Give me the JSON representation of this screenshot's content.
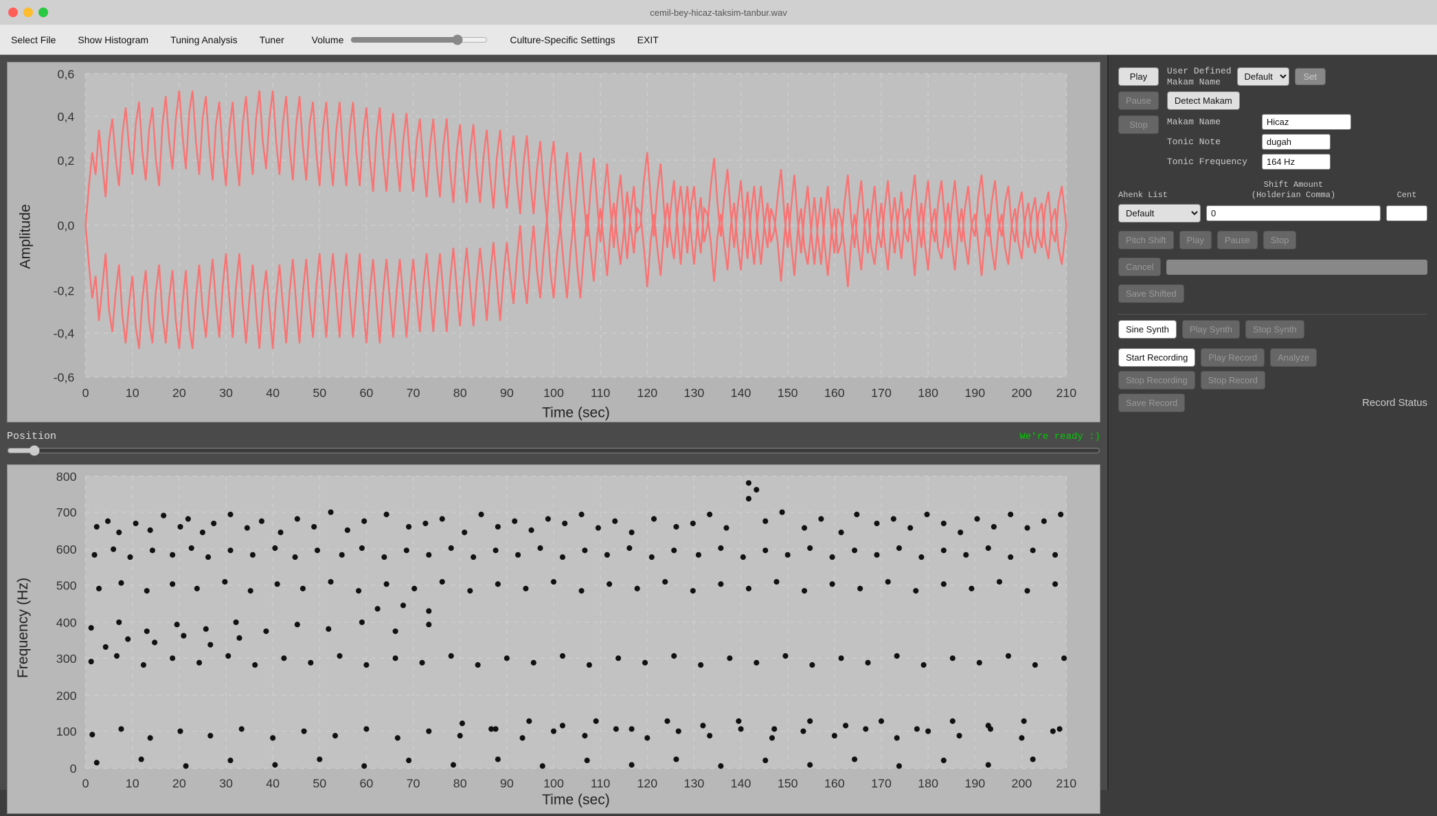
{
  "titlebar": {
    "title": "cemil-bey-hicaz-taksim-tanbur.wav",
    "close": "close",
    "minimize": "minimize",
    "maximize": "maximize"
  },
  "menubar": {
    "items": [
      {
        "id": "select-file",
        "label": "Select File"
      },
      {
        "id": "show-histogram",
        "label": "Show Histogram"
      },
      {
        "id": "tuning-analysis",
        "label": "Tuning Analysis"
      },
      {
        "id": "tuner",
        "label": "Tuner"
      },
      {
        "id": "volume",
        "label": "Volume"
      },
      {
        "id": "culture-settings",
        "label": "Culture-Specific Settings"
      },
      {
        "id": "exit",
        "label": "EXIT"
      }
    ],
    "volume_value": 80
  },
  "waveform": {
    "title": "Amplitude",
    "x_label": "Time (sec)",
    "x_ticks": [
      0,
      10,
      20,
      30,
      40,
      50,
      60,
      70,
      80,
      90,
      100,
      110,
      120,
      130,
      140,
      150,
      160,
      170,
      180,
      190,
      200,
      210
    ],
    "y_ticks": [
      0.6,
      0.4,
      0.2,
      0.0,
      -0.2,
      -0.4,
      -0.6
    ]
  },
  "position": {
    "label": "Position",
    "status": "We're ready :)",
    "value": 2
  },
  "frequency": {
    "title": "Frequency (Hz)",
    "x_label": "Time (sec)",
    "x_ticks": [
      0,
      10,
      20,
      30,
      40,
      50,
      60,
      70,
      80,
      90,
      100,
      110,
      120,
      130,
      140,
      150,
      160,
      170,
      180,
      190,
      200,
      210
    ],
    "y_ticks": [
      0,
      100,
      200,
      300,
      400,
      500,
      600,
      700,
      800
    ]
  },
  "controls": {
    "play_label": "Play",
    "pause_label": "Pause",
    "stop_label": "Stop",
    "user_defined_makam": "User Defined\nMakam Name",
    "user_defined_makam_line1": "User Defined",
    "user_defined_makam_line2": "Makam Name",
    "default_dropdown": "Default",
    "set_label": "Set",
    "detect_makam_label": "Detect Makam",
    "makam_name_label": "Makam Name",
    "makam_name_value": "Hicaz",
    "tonic_note_label": "Tonic Note",
    "tonic_note_value": "dugah",
    "tonic_freq_label": "Tonic Frequency",
    "tonic_freq_value": "164 Hz",
    "ahenk_list_label": "Ahenk List",
    "shift_amount_label": "Shift Amount",
    "shift_sublabel": "(Holderian Comma)",
    "cent_label": "Cent",
    "ahenk_dropdown": "Default",
    "shift_value": "0",
    "pitch_shift_label": "Pitch Shift",
    "pitch_play_label": "Play",
    "pitch_pause_label": "Pause",
    "pitch_stop_label": "Stop",
    "cancel_label": "Cancel",
    "save_shifted_label": "Save Shifted",
    "sine_synth_label": "Sine Synth",
    "play_synth_label": "Play Synth",
    "stop_synth_label": "Stop Synth",
    "start_recording_label": "Start Recording",
    "play_record_label": "Play Record",
    "analyze_label": "Analyze",
    "stop_recording_label": "Stop Recording",
    "stop_record_label": "Stop Record",
    "save_record_label": "Save Record",
    "record_status_label": "Record Status"
  }
}
